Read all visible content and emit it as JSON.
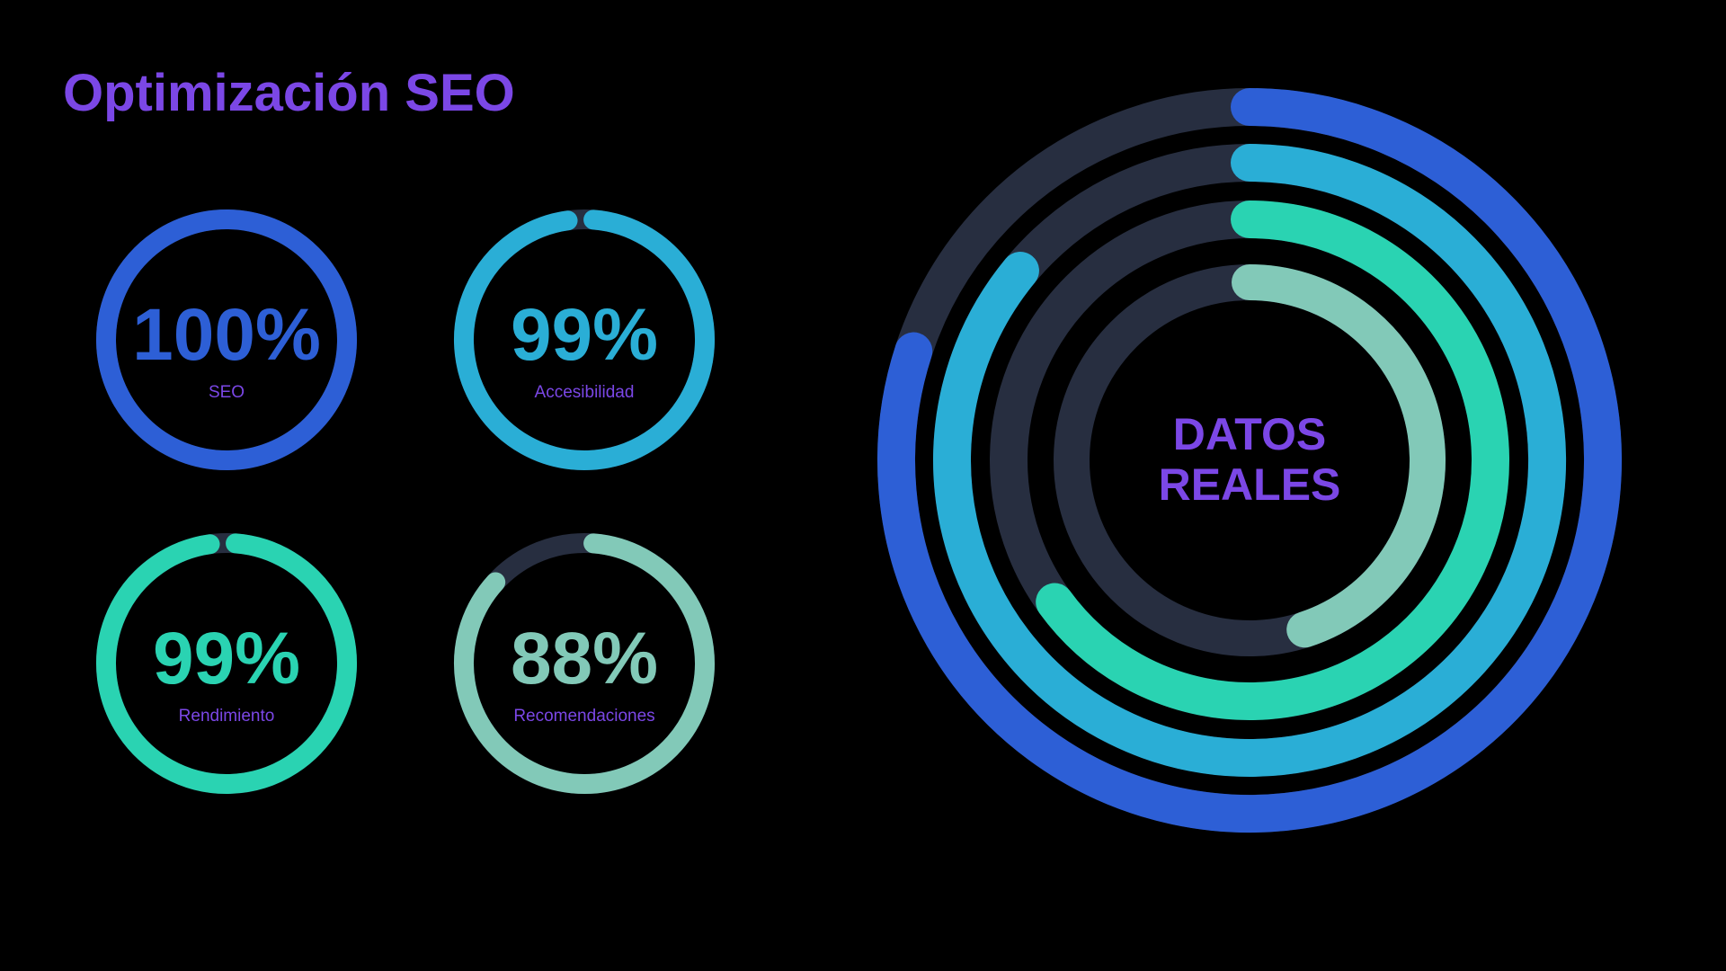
{
  "title": "Optimización SEO",
  "colors": {
    "background": "#000000",
    "track": "#272e40",
    "title": "#7b47e6",
    "label": "#7b47e6",
    "center_text": "#7b47e6"
  },
  "chart_data": [
    {
      "type": "donut",
      "cards": [
        {
          "value": 100,
          "display": "100%",
          "label": "SEO",
          "color": "#2d5fd6"
        },
        {
          "value": 99,
          "display": "99%",
          "label": "Accesibilidad",
          "color": "#2aaed6"
        },
        {
          "value": 99,
          "display": "99%",
          "label": "Rendimiento",
          "color": "#2ad3b2"
        },
        {
          "value": 88,
          "display": "88%",
          "label": "Recomendaciones",
          "color": "#82c9b8"
        }
      ]
    },
    {
      "type": "radial-bar",
      "center_label_line1": "DATOS",
      "center_label_line2": "REALES",
      "rings": [
        {
          "value": 80,
          "color": "#2d5fd6"
        },
        {
          "value": 86,
          "color": "#2aaed6"
        },
        {
          "value": 65,
          "color": "#2ad3b2"
        },
        {
          "value": 45,
          "color": "#82c9b8"
        }
      ]
    }
  ]
}
